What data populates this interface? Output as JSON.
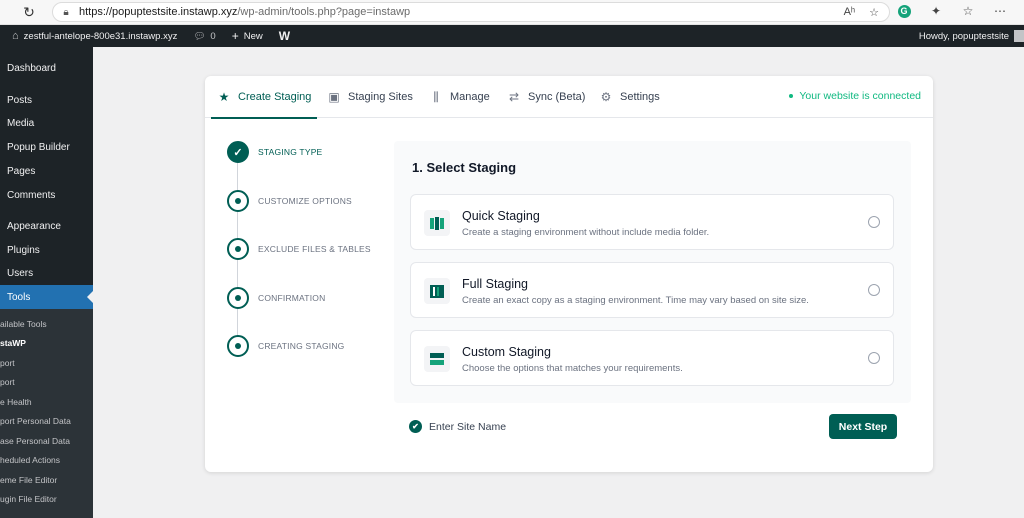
{
  "browser": {
    "url_host": "https://popuptestsite.instawp.xyz",
    "url_path": "/wp-admin/tools.php?page=instawp"
  },
  "admin_bar": {
    "site_name": "zestful-antelope-800e31.instawp.xyz",
    "comments_count": "0",
    "new_label": "New",
    "greeting": "Howdy, popuptestsite"
  },
  "sidebar": {
    "items": [
      {
        "label": "Dashboard"
      },
      {
        "label": "Posts"
      },
      {
        "label": "Media"
      },
      {
        "label": "Popup Builder"
      },
      {
        "label": "Pages"
      },
      {
        "label": "Comments"
      },
      {
        "label": "Appearance"
      },
      {
        "label": "Plugins"
      },
      {
        "label": "Users"
      },
      {
        "label": "Tools"
      }
    ],
    "submenu": [
      {
        "label": "ailable Tools"
      },
      {
        "label": "staWP"
      },
      {
        "label": "port"
      },
      {
        "label": "port"
      },
      {
        "label": "e Health"
      },
      {
        "label": "port Personal Data"
      },
      {
        "label": "ase Personal Data"
      },
      {
        "label": "heduled Actions"
      },
      {
        "label": "eme File Editor"
      },
      {
        "label": "ugin File Editor"
      }
    ]
  },
  "tabs": [
    {
      "label": "Create Staging",
      "icon": "star-icon"
    },
    {
      "label": "Staging Sites",
      "icon": "box-icon"
    },
    {
      "label": "Manage",
      "icon": "sliders-icon"
    },
    {
      "label": "Sync (Beta)",
      "icon": "sync-icon"
    },
    {
      "label": "Settings",
      "icon": "gear-icon"
    }
  ],
  "status": {
    "connected": "Your website is connected",
    "color": "#10b981"
  },
  "steps": [
    {
      "label": "STAGING TYPE",
      "state": "done"
    },
    {
      "label": "CUSTOMIZE OPTIONS",
      "state": "pending"
    },
    {
      "label": "EXCLUDE FILES & TABLES",
      "state": "pending"
    },
    {
      "label": "CONFIRMATION",
      "state": "pending"
    },
    {
      "label": "CREATING STAGING",
      "state": "pending"
    }
  ],
  "panel": {
    "title": "1. Select Staging",
    "options": [
      {
        "title": "Quick Staging",
        "desc": "Create a staging environment without include media folder."
      },
      {
        "title": "Full Staging",
        "desc": "Create an exact copy as a staging environment. Time may vary based on site size."
      },
      {
        "title": "Custom Staging",
        "desc": "Choose the options that matches your requirements."
      }
    ]
  },
  "footer": {
    "site_name_placeholder": "Enter Site Name",
    "next_label": "Next Step"
  },
  "colors": {
    "accent": "#005e54",
    "wp_admin": "#1d2327",
    "wp_active": "#2271b1"
  }
}
